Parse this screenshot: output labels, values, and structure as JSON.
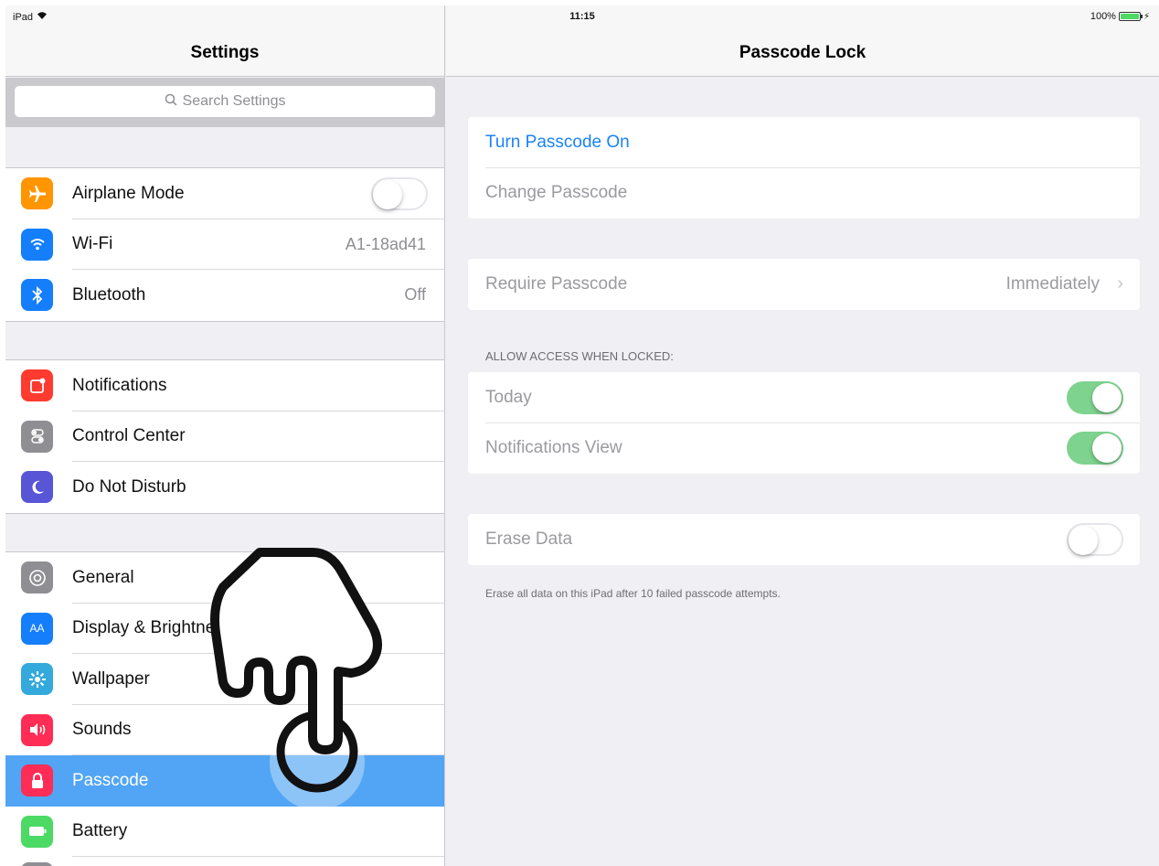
{
  "status_bar": {
    "device": "iPad",
    "time": "11:15",
    "battery": "100%",
    "battery_level": 1.0
  },
  "left": {
    "title": "Settings",
    "search_placeholder": "Search Settings",
    "group1": [
      {
        "label": "Airplane Mode",
        "icon": "airplane-icon",
        "color": "#ff9500",
        "toggle": "off"
      },
      {
        "label": "Wi-Fi",
        "icon": "wifi-icon",
        "color": "#147efb",
        "value": "A1-18ad41"
      },
      {
        "label": "Bluetooth",
        "icon": "bluetooth-icon",
        "color": "#147efb",
        "value": "Off"
      }
    ],
    "group2": [
      {
        "label": "Notifications",
        "icon": "notifications-icon",
        "color": "#ff3b30"
      },
      {
        "label": "Control Center",
        "icon": "control-center-icon",
        "color": "#8e8e93"
      },
      {
        "label": "Do Not Disturb",
        "icon": "moon-icon",
        "color": "#5856d6"
      }
    ],
    "group3": [
      {
        "label": "General",
        "icon": "gear-icon",
        "color": "#8e8e93"
      },
      {
        "label": "Display & Brightness",
        "icon": "display-icon",
        "color": "#147efb"
      },
      {
        "label": "Wallpaper",
        "icon": "wallpaper-icon",
        "color": "#34aadc"
      },
      {
        "label": "Sounds",
        "icon": "sound-icon",
        "color": "#ff2d55"
      },
      {
        "label": "Passcode",
        "icon": "lock-icon",
        "color": "#ff2d55",
        "selected": true
      },
      {
        "label": "Battery",
        "icon": "battery-icon",
        "color": "#4cd964"
      }
    ]
  },
  "right": {
    "title": "Passcode Lock",
    "turn_on": "Turn Passcode On",
    "change": "Change Passcode",
    "require_label": "Require Passcode",
    "require_value": "Immediately",
    "allow_header": "ALLOW ACCESS WHEN LOCKED:",
    "today": "Today",
    "notifications_view": "Notifications View",
    "erase_data": "Erase Data",
    "erase_note": "Erase all data on this iPad after 10 failed passcode attempts."
  },
  "colors": {
    "accent": "#1a82fb",
    "selected_row": "#51a5f4",
    "toggle_on": "#7ed38e"
  }
}
